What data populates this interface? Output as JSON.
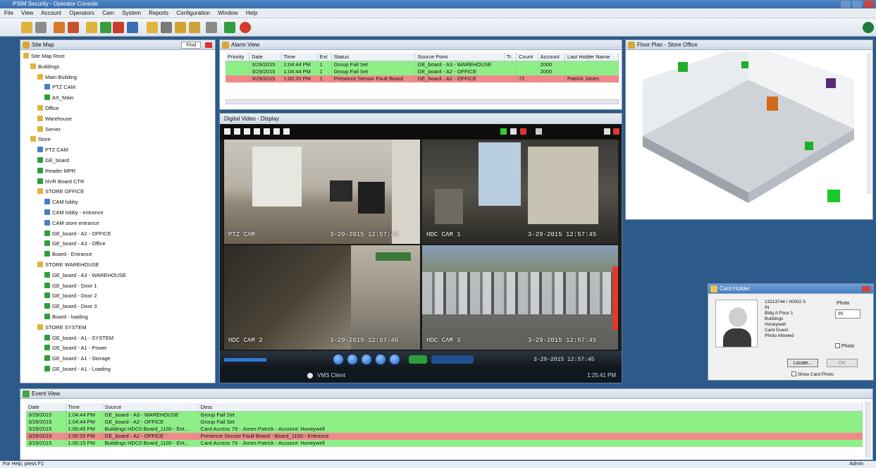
{
  "app": {
    "title": "PSIM Security - Operator Console"
  },
  "menu": [
    "File",
    "View",
    "Account",
    "Operators",
    "Cam",
    "System",
    "Reports",
    "Configuration",
    "Window",
    "Help"
  ],
  "site_map": {
    "title": "Site Map",
    "search_label": "Find",
    "tree": [
      {
        "label": "Site Map Root",
        "level": 0,
        "icon": "folder-icon"
      },
      {
        "label": "Buildings",
        "level": 1,
        "icon": "folder-icon"
      },
      {
        "label": "Main Building",
        "level": 2,
        "icon": "folder-icon"
      },
      {
        "label": "PTZ CAM",
        "level": 3,
        "icon": "camera-icon"
      },
      {
        "label": "AX_Main",
        "level": 3,
        "icon": "device-icon"
      },
      {
        "label": "Office",
        "level": 2,
        "icon": "folder-icon"
      },
      {
        "label": "Warehouse",
        "level": 2,
        "icon": "folder-icon"
      },
      {
        "label": "Server",
        "level": 2,
        "icon": "folder-icon"
      },
      {
        "label": "Store",
        "level": 1,
        "icon": "folder-icon"
      },
      {
        "label": "PTZ CAM",
        "level": 2,
        "icon": "camera-icon"
      },
      {
        "label": "GE_board",
        "level": 2,
        "icon": "device-icon"
      },
      {
        "label": "Reader MPR",
        "level": 2,
        "icon": "device-icon"
      },
      {
        "label": "NVR Board CTR",
        "level": 2,
        "icon": "device-icon"
      },
      {
        "label": "STORE OFFICE",
        "level": 2,
        "icon": "folder-icon"
      },
      {
        "label": "CAM lobby",
        "level": 3,
        "icon": "camera-icon"
      },
      {
        "label": "CAM lobby - entrance",
        "level": 3,
        "icon": "camera-icon"
      },
      {
        "label": "CAM store entrance",
        "level": 3,
        "icon": "camera-icon"
      },
      {
        "label": "GE_board - A2 - OFFICE",
        "level": 3,
        "icon": "device-icon"
      },
      {
        "label": "GE_board - A3 - Office",
        "level": 3,
        "icon": "device-icon"
      },
      {
        "label": "Board - Entrance",
        "level": 3,
        "icon": "device-icon"
      },
      {
        "label": "STORE WAREHOUSE",
        "level": 2,
        "icon": "folder-icon"
      },
      {
        "label": "GE_board - A3 - WAREHOUSE",
        "level": 3,
        "icon": "device-icon"
      },
      {
        "label": "GE_board - Door 1",
        "level": 3,
        "icon": "device-icon"
      },
      {
        "label": "GE_board - Door 2",
        "level": 3,
        "icon": "device-icon"
      },
      {
        "label": "GE_board - Door 3",
        "level": 3,
        "icon": "device-icon"
      },
      {
        "label": "Board - loading",
        "level": 3,
        "icon": "device-icon"
      },
      {
        "label": "STORE SYSTEM",
        "level": 2,
        "icon": "folder-icon"
      },
      {
        "label": "GE_board - A1 - SYSTEM",
        "level": 3,
        "icon": "device-icon"
      },
      {
        "label": "GE_board - A1 - Power",
        "level": 3,
        "icon": "device-icon"
      },
      {
        "label": "GE_board - A1 - Storage",
        "level": 3,
        "icon": "device-icon"
      },
      {
        "label": "GE_board - A1 - Loading",
        "level": 3,
        "icon": "device-icon"
      }
    ]
  },
  "alarm_view": {
    "title": "Alarm View",
    "columns": [
      "Priority",
      "Date",
      "Time",
      "Ext",
      "Status",
      "Source Point",
      "Tr.",
      "Count",
      "Account",
      "Last Holder Name"
    ],
    "rows": [
      {
        "cells": [
          "",
          "3/29/2015",
          "1:04:44 PM",
          "1",
          "Group Fail Set",
          "GE_board - A3 - WAREHOUSE",
          "",
          "",
          "2000",
          ""
        ],
        "color": "green"
      },
      {
        "cells": [
          "",
          "3/29/2015",
          "1:04:44 PM",
          "1",
          "Group Fail Set",
          "GE_board - A2 - OFFICE",
          "",
          "",
          "2000",
          ""
        ],
        "color": "green"
      },
      {
        "cells": [
          "",
          "3/29/2015",
          "1:00:20 PM",
          "1",
          "Presence Sensor Fault Board",
          "GE_board - A2 - OFFICE",
          "",
          "72",
          "",
          "Patrick Jones"
        ],
        "color": "red"
      }
    ]
  },
  "video": {
    "title": "Digital Video - Display",
    "cams": [
      {
        "label": "PTZ CAM",
        "timestamp": "3-29-2015 12:57:45"
      },
      {
        "label": "HDC CAM 1",
        "timestamp": "3-29-2015 12:57:45"
      },
      {
        "label": "HDC CAM 2",
        "timestamp": "3-29-2015 12:57:45"
      },
      {
        "label": "HDC CAM 3",
        "timestamp": "3-29-2015 12:57:45"
      }
    ],
    "playback_date": "3-29-2015 12:57:45",
    "status_text": "VMS Client",
    "status_time": "1:25:41 PM"
  },
  "floor_plan": {
    "title": "Floor Plan - Store Office"
  },
  "card_holder": {
    "title": "Card Holder",
    "lines": [
      "13213744 / 00002 5",
      "IN",
      "Bldg A Floor 1",
      "Buildings",
      "Honeywell",
      "Card Guest",
      "Photo Allowed"
    ],
    "field_label": "Photo",
    "field_value": "IN",
    "checkbox_label": "Photo",
    "button_locate": "Locate...",
    "button_ok": "OK",
    "checkbox2_label": "Show Card Photo"
  },
  "event_view": {
    "title": "Event View",
    "columns": [
      "Date",
      "Time",
      "Source",
      "Desc"
    ],
    "rows": [
      {
        "cells": [
          "3/29/2015",
          "1:04:44 PM",
          "GE_board - A3 - WAREHOUSE",
          "Group Fail Set"
        ],
        "color": "green"
      },
      {
        "cells": [
          "3/29/2015",
          "1:04:44 PM",
          "GE_board - A2 - OFFICE",
          "Group Fail Set"
        ],
        "color": "green"
      },
      {
        "cells": [
          "3/29/2015",
          "1:00:45 PM",
          "Buildings HDC0 Board_1100 - Ent...",
          "Card Access 79 - Jones Patrick - Account: Honeywell"
        ],
        "color": "green"
      },
      {
        "cells": [
          "3/29/2015",
          "1:00:20 PM",
          "GE_board - A2 - OFFICE",
          "Presence Sensor Fault Board - Board_1100 - Entrance"
        ],
        "color": "red"
      },
      {
        "cells": [
          "3/29/2015",
          "1:00:15 PM",
          "Buildings HDC0 Board_1100 - Ent...",
          "Card Access 79 - Jones Patrick - Account: Honeywell"
        ],
        "color": "green"
      }
    ]
  },
  "status_bar": {
    "left": "For Help, press F1",
    "right": "Admin"
  },
  "colors": {
    "ok": "#8fef87",
    "alarm": "#f08a8a",
    "desktop": "#2c5a8a"
  }
}
